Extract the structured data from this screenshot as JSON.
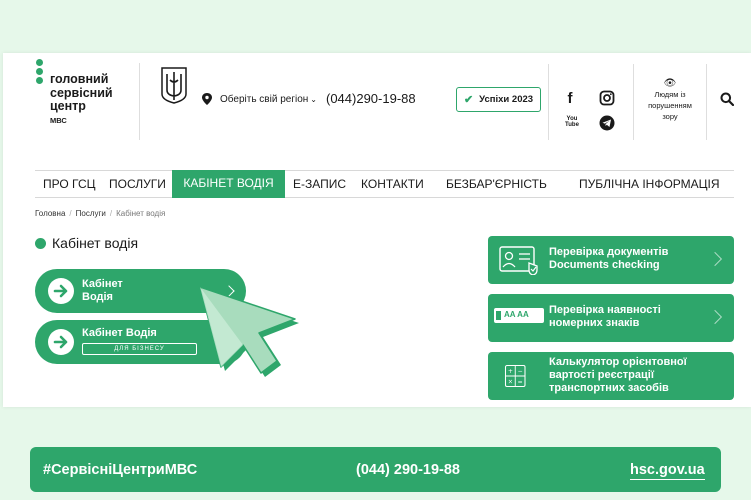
{
  "header": {
    "logo_line1": "головний",
    "logo_line2": "сервісний",
    "logo_line3": "центр",
    "logo_sub": "МВС",
    "region_label": "Оберіть свій регіон",
    "phone": "(044)290-19-88",
    "success_label": "Успіхи 2023",
    "youtube_label": "You Tube",
    "accessibility_line1": "Людям із",
    "accessibility_line2": "порушенням",
    "accessibility_line3": "зору"
  },
  "nav": {
    "items": [
      {
        "label": "ПРО ГСЦ"
      },
      {
        "label": "ПОСЛУГИ"
      },
      {
        "label": "КАБІНЕТ ВОДІЯ"
      },
      {
        "label": "Е-ЗАПИС"
      },
      {
        "label": "КОНТАКТИ"
      },
      {
        "label": "БЕЗБАР'ЄРНІСТЬ"
      },
      {
        "label": "ПУБЛІЧНА ІНФОРМАЦІЯ"
      }
    ],
    "active_index": 2
  },
  "breadcrumb": {
    "home": "Головна",
    "services": "Послуги",
    "current": "Кабінет водія",
    "separator": "/"
  },
  "main": {
    "title": "Кабінет водія",
    "cabinet_line1": "Кабінет",
    "cabinet_line2": "Водія",
    "business_line1": "Кабінет Водія",
    "business_badge": "ДЛЯ БІЗНЕСУ"
  },
  "cards": [
    {
      "line1": "Перевірка документів",
      "line2": "Documents checking",
      "line3": "",
      "icon": "id-card-icon"
    },
    {
      "line1": "Перевірка наявності",
      "line2": "номерних знаків",
      "line3": "",
      "icon": "license-plate-icon",
      "plate_text": "AA AA"
    },
    {
      "line1": "Калькулятор орієнтовної",
      "line2": "вартості реєстрації",
      "line3": "транспортних засобів",
      "icon": "calculator-icon"
    }
  ],
  "footer": {
    "hashtag": "#СервісніЦентриМВС",
    "phone": "(044) 290-19-88",
    "site": "hsc.gov.ua"
  },
  "colors": {
    "accent": "#2ea66b",
    "background": "#e6f8ea",
    "card": "#ffffff"
  }
}
